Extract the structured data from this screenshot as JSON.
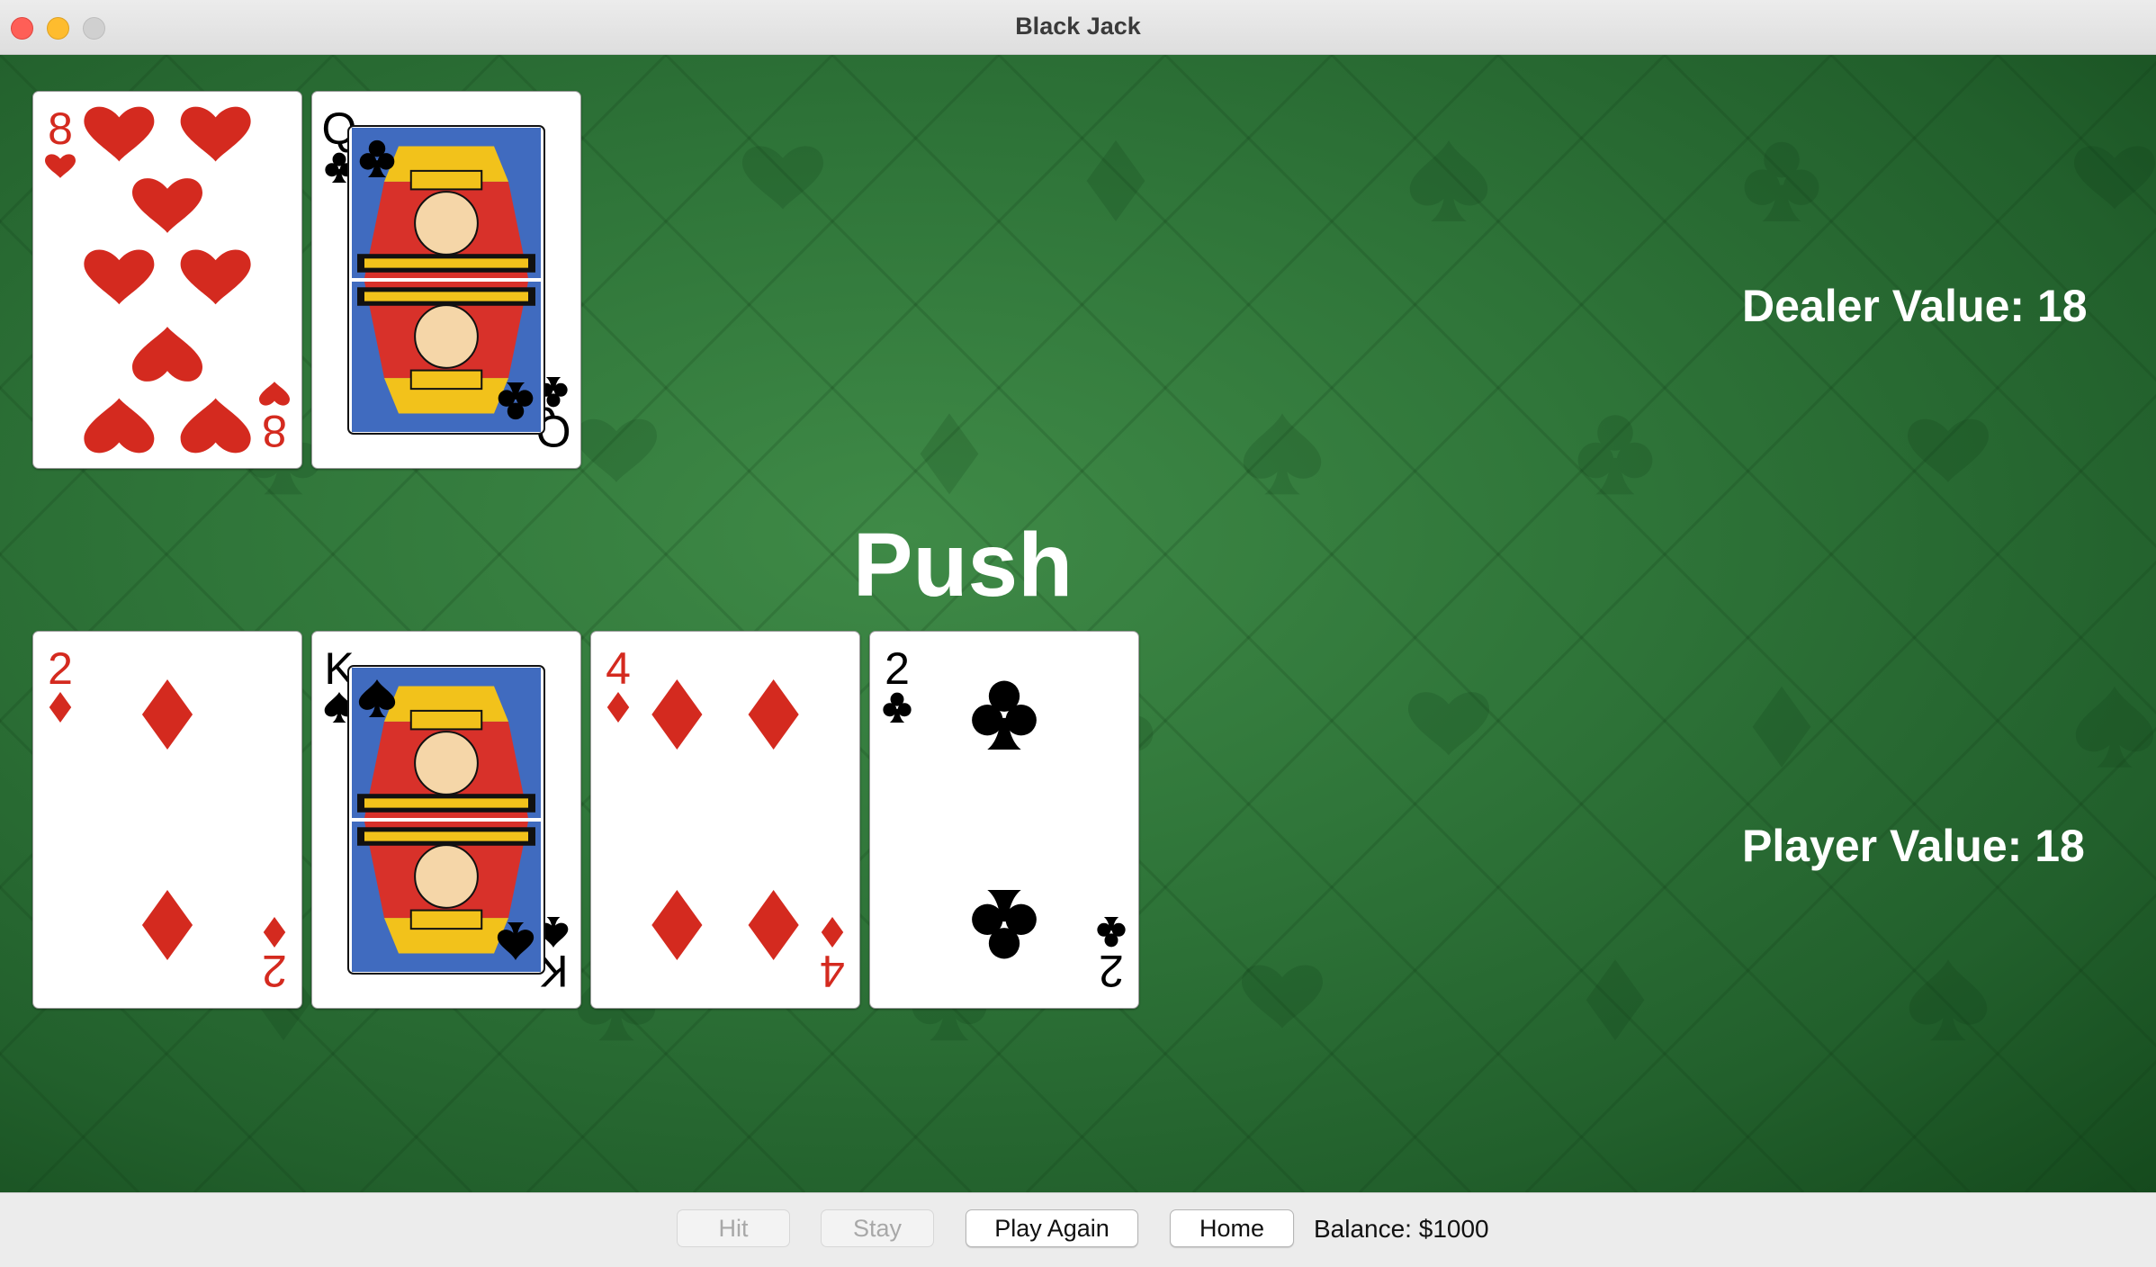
{
  "window": {
    "title": "Black Jack"
  },
  "dealer": {
    "value_label": "Dealer Value: 18",
    "cards": [
      {
        "rank": "8",
        "suit": "hearts",
        "color": "#d42a1f"
      },
      {
        "rank": "Q",
        "suit": "clubs",
        "color": "#000000"
      }
    ]
  },
  "player": {
    "value_label": "Player Value: 18",
    "cards": [
      {
        "rank": "2",
        "suit": "diamonds",
        "color": "#d42a1f"
      },
      {
        "rank": "K",
        "suit": "spades",
        "color": "#000000"
      },
      {
        "rank": "4",
        "suit": "diamonds",
        "color": "#d42a1f"
      },
      {
        "rank": "2",
        "suit": "clubs",
        "color": "#000000"
      }
    ]
  },
  "result_text": "Push",
  "controls": {
    "hit_label": "Hit",
    "stay_label": "Stay",
    "play_again_label": "Play Again",
    "home_label": "Home",
    "balance_text": "Balance: $1000"
  },
  "colors": {
    "felt": "#2f7539",
    "red_suit": "#d42a1f",
    "black_suit": "#000000"
  }
}
